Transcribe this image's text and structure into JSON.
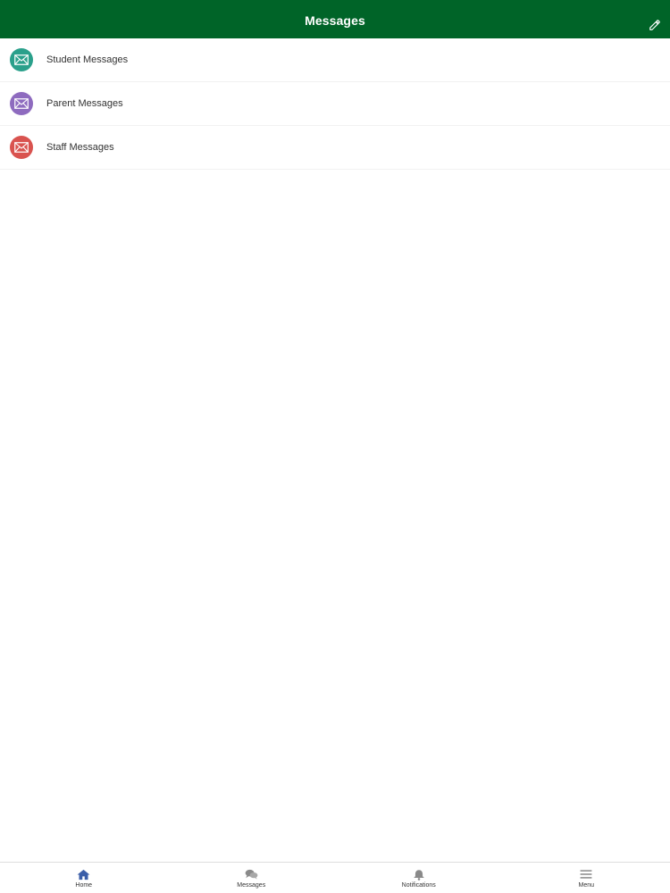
{
  "header": {
    "title": "Messages",
    "background": "#006428",
    "compose_icon": "pencil-icon"
  },
  "messages": {
    "items": [
      {
        "label": "Student Messages",
        "icon": "envelope-icon",
        "color": "#2aa08b"
      },
      {
        "label": "Parent Messages",
        "icon": "envelope-icon",
        "color": "#8e6bbf"
      },
      {
        "label": "Staff Messages",
        "icon": "envelope-icon",
        "color": "#d9534f"
      }
    ]
  },
  "tabbar": {
    "tabs": [
      {
        "label": "Home",
        "icon": "home-icon",
        "color": "#3b5ea8"
      },
      {
        "label": "Messages",
        "icon": "chat-bubbles-icon",
        "color": "#888888"
      },
      {
        "label": "Notifications",
        "icon": "bell-icon",
        "color": "#888888"
      },
      {
        "label": "Menu",
        "icon": "hamburger-menu-icon",
        "color": "#888888"
      }
    ]
  }
}
